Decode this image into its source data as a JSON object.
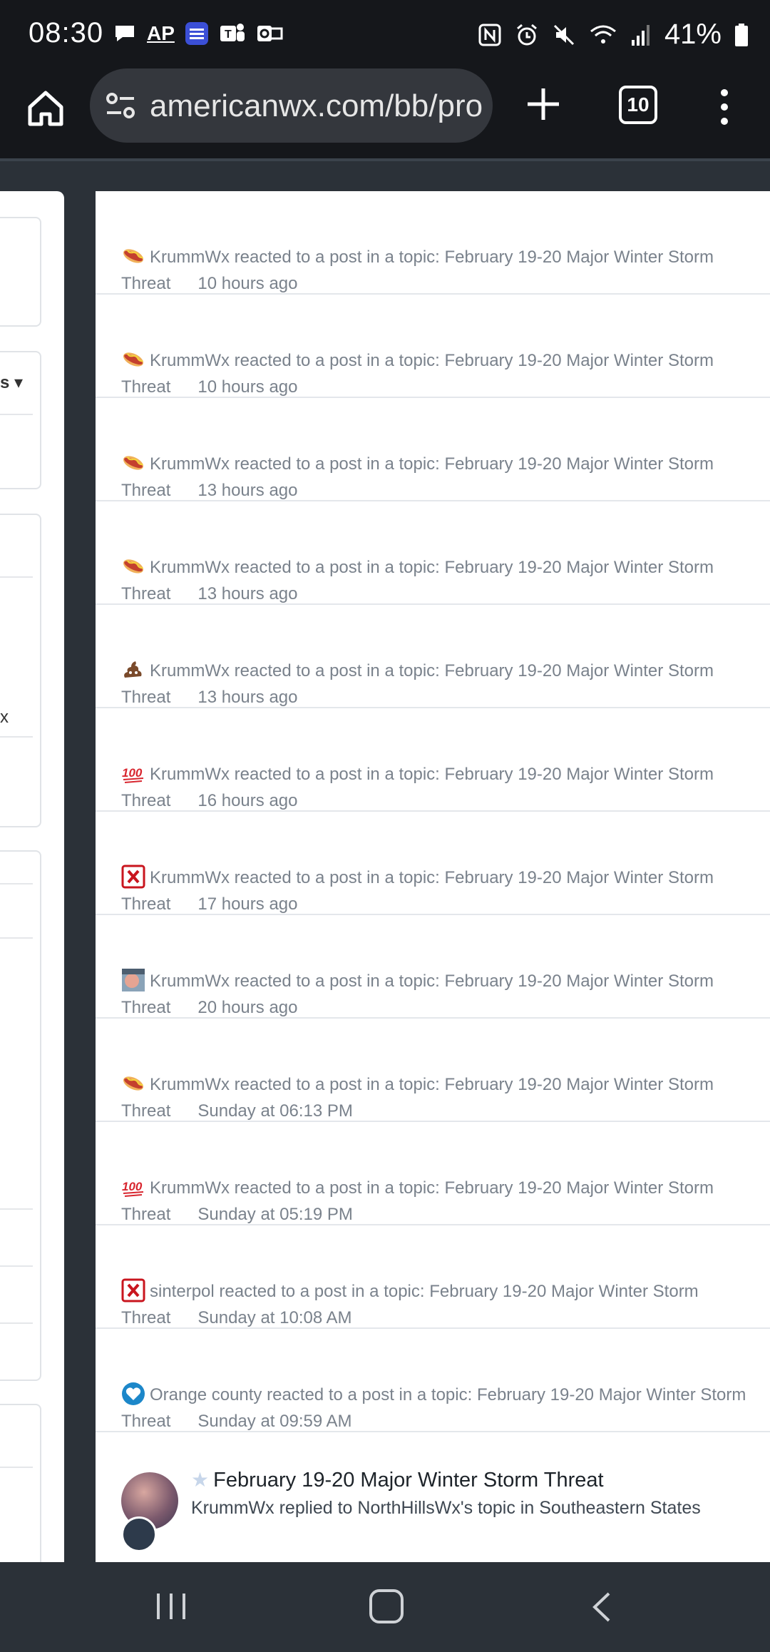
{
  "status_bar": {
    "time": "08:30",
    "battery": "41%",
    "left_icons": [
      "chat-bubble-icon",
      "ap-news-icon",
      "weather-channel-icon",
      "teams-icon",
      "outlook-icon"
    ],
    "left_icon_labels": {
      "ap": "AP"
    },
    "right_icons": [
      "nfc-icon",
      "alarm-icon",
      "mute-icon",
      "wifi-icon",
      "signal-icon",
      "battery-icon"
    ]
  },
  "browser": {
    "url": "americanwx.com/bb/pro",
    "tab_count": "10"
  },
  "left_panel": {
    "dropdown_fragment": "s ▾",
    "text_fragment": "x"
  },
  "feed": {
    "items": [
      {
        "icon": "hotdog-icon",
        "text": "KrummWx reacted to a post in a topic: February 19-20 Major Winter Storm Threat",
        "time": "10 hours ago"
      },
      {
        "icon": "hotdog-icon",
        "text": "KrummWx reacted to a post in a topic: February 19-20 Major Winter Storm Threat",
        "time": "10 hours ago"
      },
      {
        "icon": "hotdog-icon",
        "text": "KrummWx reacted to a post in a topic: February 19-20 Major Winter Storm Threat",
        "time": "13 hours ago"
      },
      {
        "icon": "hotdog-icon",
        "text": "KrummWx reacted to a post in a topic: February 19-20 Major Winter Storm Threat",
        "time": "13 hours ago"
      },
      {
        "icon": "poop-icon",
        "text": "KrummWx reacted to a post in a topic: February 19-20 Major Winter Storm Threat",
        "time": "13 hours ago"
      },
      {
        "icon": "hundred-icon",
        "text": "KrummWx reacted to a post in a topic: February 19-20 Major Winter Storm Threat",
        "time": "16 hours ago"
      },
      {
        "icon": "red-x-icon",
        "text": "KrummWx reacted to a post in a topic: February 19-20 Major Winter Storm Threat",
        "time": "17 hours ago"
      },
      {
        "icon": "face-icon",
        "text": "KrummWx reacted to a post in a topic: February 19-20 Major Winter Storm Threat",
        "time": "20 hours ago"
      },
      {
        "icon": "hotdog-icon",
        "text": "KrummWx reacted to a post in a topic: February 19-20 Major Winter Storm Threat",
        "time": "Sunday at 06:13 PM"
      },
      {
        "icon": "hundred-icon",
        "text": "KrummWx reacted to a post in a topic: February 19-20 Major Winter Storm Threat",
        "time": "Sunday at 05:19 PM"
      },
      {
        "icon": "red-x-icon",
        "text": "sinterpol reacted to a post in a topic: February 19-20 Major Winter Storm Threat",
        "time": "Sunday at 10:08 AM"
      },
      {
        "icon": "heart-icon",
        "text": "Orange county reacted to a post in a topic: February 19-20 Major Winter Storm Threat",
        "time": "Sunday at 09:59 AM"
      }
    ],
    "last_item": {
      "title": "February 19-20 Major Winter Storm Threat",
      "subtitle": "KrummWx replied to NorthHillsWx's topic in Southeastern States"
    }
  }
}
